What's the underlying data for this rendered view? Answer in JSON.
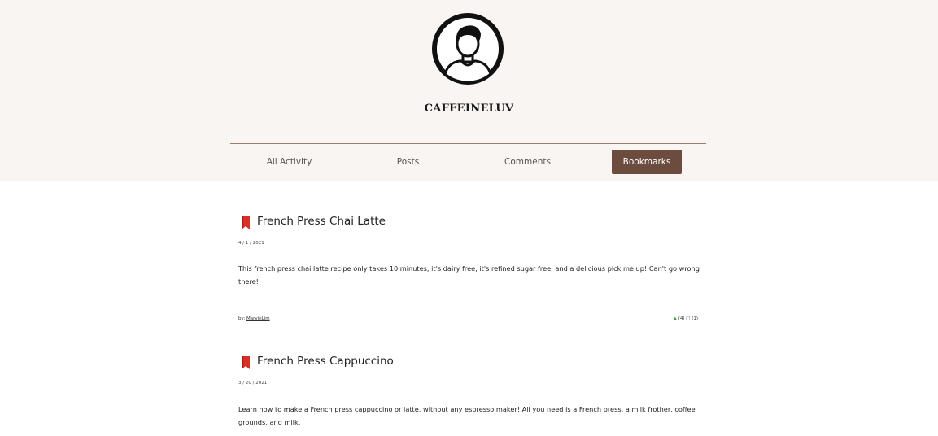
{
  "profile": {
    "username": "CAFFEINELUV",
    "avatar_icon": "user-avatar-icon"
  },
  "tabs": [
    {
      "label": "All Activity",
      "active": false
    },
    {
      "label": "Posts",
      "active": false
    },
    {
      "label": "Comments",
      "active": false
    },
    {
      "label": "Bookmarks",
      "active": true
    }
  ],
  "colors": {
    "header_bg": "#f9f5f2",
    "accent": "#6b4c3e",
    "bookmark": "#d93025",
    "like": "#3a9e3a"
  },
  "posts": [
    {
      "title": "French Press Chai Latte",
      "date": "4 / 1 / 2021",
      "body": "This french press chai latte recipe only takes 10 minutes, it's dairy free, it's refined sugar free, and a delicious pick me up! Can't go wrong there!",
      "by_label": "by:",
      "author": "MarvinLim",
      "likes": "(4)",
      "comments": "(1)",
      "icon": "bookmark-icon"
    },
    {
      "title": "French Press Cappuccino",
      "date": "3 / 20 / 2021",
      "body": "Learn how to make a French press cappuccino or latte, without any espresso maker! All you need is a French press, a milk frother, coffee grounds, and milk.",
      "icon": "bookmark-icon"
    }
  ]
}
